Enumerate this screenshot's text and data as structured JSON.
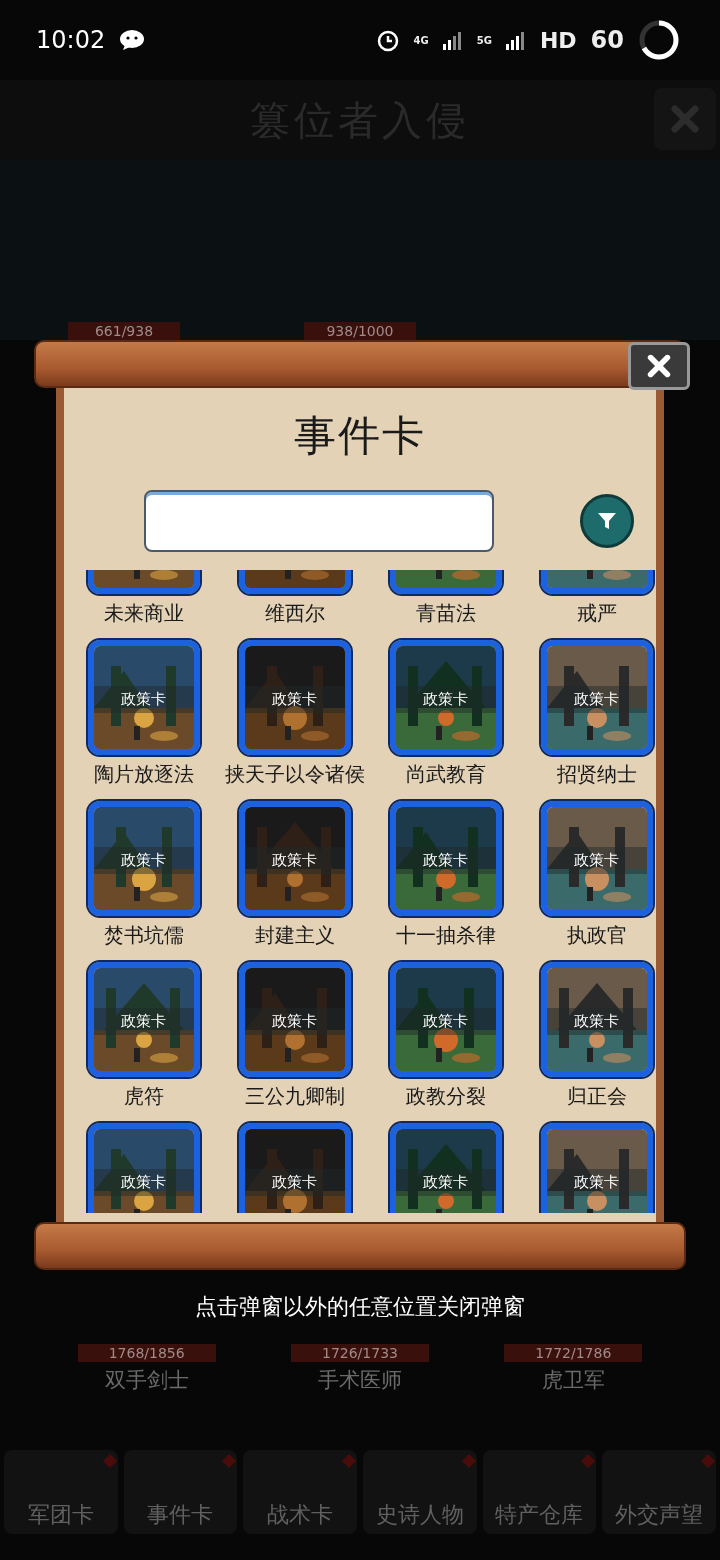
{
  "status_bar": {
    "time": "10:02",
    "network_1": "4G",
    "network_2": "5G",
    "hd": "HD",
    "refresh_rate": "60"
  },
  "background": {
    "title": "篡位者入侵",
    "top_counts": [
      "661/938",
      "938/1000"
    ],
    "units": [
      {
        "count": "1768/1856",
        "name": "双手剑士"
      },
      {
        "count": "1726/1733",
        "name": "手术医师"
      },
      {
        "count": "1772/1786",
        "name": "虎卫军"
      }
    ],
    "bottom_nav": [
      {
        "label": "军团卡"
      },
      {
        "label": "事件卡"
      },
      {
        "label": "战术卡"
      },
      {
        "label": "史诗人物"
      },
      {
        "label": "特产仓库"
      },
      {
        "label": "外交声望"
      }
    ]
  },
  "dialog": {
    "title": "事件卡",
    "cards": [
      {
        "label": "未来商业"
      },
      {
        "label": "维西尔"
      },
      {
        "label": "青苗法"
      },
      {
        "label": "戒严"
      },
      {
        "badge": "政策卡",
        "label": "陶片放逐法"
      },
      {
        "badge": "政策卡",
        "label": "挟天子以令诸侯"
      },
      {
        "badge": "政策卡",
        "label": "尚武教育"
      },
      {
        "badge": "政策卡",
        "label": "招贤纳士"
      },
      {
        "badge": "政策卡",
        "label": "焚书坑儒"
      },
      {
        "badge": "政策卡",
        "label": "封建主义"
      },
      {
        "badge": "政策卡",
        "label": "十一抽杀律"
      },
      {
        "badge": "政策卡",
        "label": "执政官"
      },
      {
        "badge": "政策卡",
        "label": "虎符"
      },
      {
        "badge": "政策卡",
        "label": "三公九卿制"
      },
      {
        "badge": "政策卡",
        "label": "政教分裂"
      },
      {
        "badge": "政策卡",
        "label": "归正会"
      },
      {
        "badge": "政策卡"
      },
      {
        "badge": "政策卡"
      },
      {
        "badge": "政策卡"
      },
      {
        "badge": "政策卡"
      }
    ]
  },
  "hint": "点击弹窗以外的任意位置关闭弹窗"
}
